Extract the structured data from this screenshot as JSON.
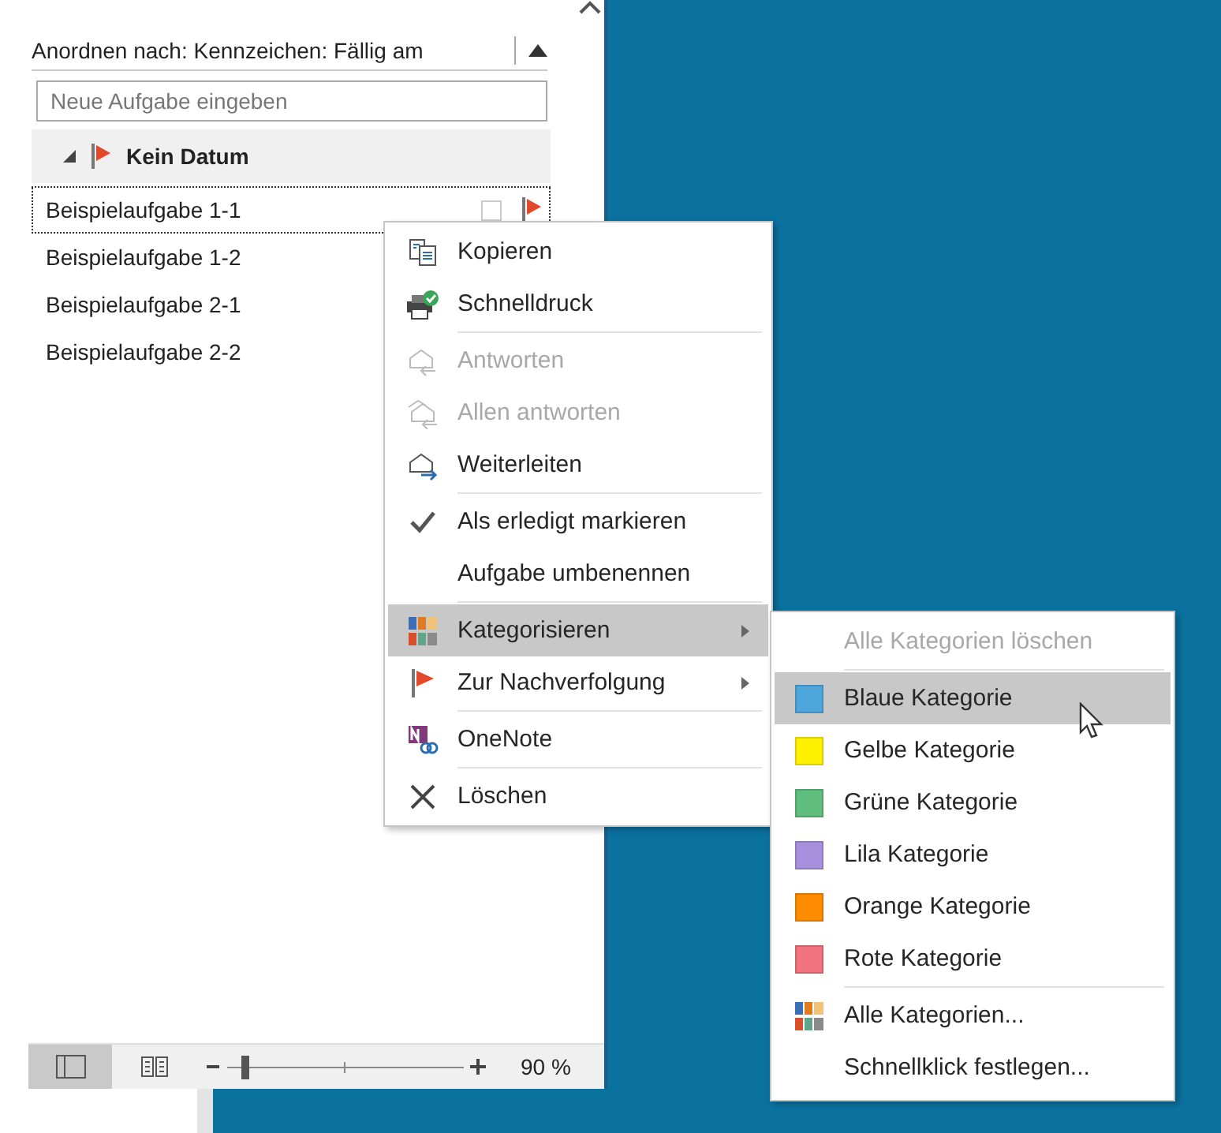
{
  "task_list": {
    "arrange_label": "Anordnen nach: Kennzeichen: Fällig am",
    "new_task": {
      "placeholder": "Neue Aufgabe eingeben"
    },
    "group": {
      "title": "Kein Datum",
      "expanded": true
    },
    "tasks": [
      {
        "title": "Beispielaufgabe 1-1",
        "focused": true
      },
      {
        "title": "Beispielaufgabe 1-2",
        "focused": false
      },
      {
        "title": "Beispielaufgabe 2-1",
        "focused": false
      },
      {
        "title": "Beispielaufgabe 2-2",
        "focused": false
      }
    ]
  },
  "status_bar": {
    "views": [
      {
        "kind": "normal",
        "selected": true
      },
      {
        "kind": "reading",
        "selected": false
      }
    ],
    "zoom": {
      "level": 0.07,
      "reading": "90 %"
    }
  },
  "context_menu": [
    {
      "label": "Kopieren",
      "disabled": false,
      "highlighted": false,
      "submenu": false,
      "separator_before": false
    },
    {
      "label": "Schnelldruck",
      "disabled": false,
      "highlighted": false,
      "submenu": false,
      "separator_before": false
    },
    {
      "label": "Antworten",
      "disabled": true,
      "highlighted": false,
      "submenu": false,
      "separator_before": true
    },
    {
      "label": "Allen antworten",
      "disabled": true,
      "highlighted": false,
      "submenu": false,
      "separator_before": false
    },
    {
      "label": "Weiterleiten",
      "disabled": false,
      "highlighted": false,
      "submenu": false,
      "separator_before": false
    },
    {
      "label": "Als erledigt markieren",
      "disabled": false,
      "highlighted": false,
      "submenu": false,
      "separator_before": true
    },
    {
      "label": "Aufgabe umbenennen",
      "disabled": false,
      "highlighted": false,
      "submenu": false,
      "separator_before": false
    },
    {
      "label": "Kategorisieren",
      "disabled": false,
      "highlighted": true,
      "submenu": true,
      "separator_before": true
    },
    {
      "label": "Zur Nachverfolgung",
      "disabled": false,
      "highlighted": false,
      "submenu": true,
      "separator_before": false
    },
    {
      "label": "OneNote",
      "disabled": false,
      "highlighted": false,
      "submenu": false,
      "separator_before": true
    },
    {
      "label": "Löschen",
      "disabled": false,
      "highlighted": false,
      "submenu": false,
      "separator_before": true
    }
  ],
  "category_submenu": [
    {
      "kind": "action",
      "label": "Alle Kategorien löschen",
      "disabled": true,
      "highlighted": false,
      "separator_before": false
    },
    {
      "kind": "category",
      "label": "Blaue Kategorie",
      "color": "#4ea6dc",
      "disabled": false,
      "highlighted": true,
      "separator_before": true
    },
    {
      "kind": "category",
      "label": "Gelbe Kategorie",
      "color": "#fff100",
      "disabled": false,
      "highlighted": false,
      "separator_before": false
    },
    {
      "kind": "category",
      "label": "Grüne Kategorie",
      "color": "#5fbe7d",
      "disabled": false,
      "highlighted": false,
      "separator_before": false
    },
    {
      "kind": "category",
      "label": "Lila Kategorie",
      "color": "#a990dd",
      "disabled": false,
      "highlighted": false,
      "separator_before": false
    },
    {
      "kind": "category",
      "label": "Orange Kategorie",
      "color": "#ff8c00",
      "disabled": false,
      "highlighted": false,
      "separator_before": false
    },
    {
      "kind": "category",
      "label": "Rote Kategorie",
      "color": "#f1737f",
      "disabled": false,
      "highlighted": false,
      "separator_before": false
    },
    {
      "kind": "all",
      "label": "Alle Kategorien...",
      "disabled": false,
      "highlighted": false,
      "separator_before": true
    },
    {
      "kind": "action",
      "label": "Schnellklick festlegen...",
      "disabled": false,
      "highlighted": false,
      "separator_before": false
    }
  ]
}
